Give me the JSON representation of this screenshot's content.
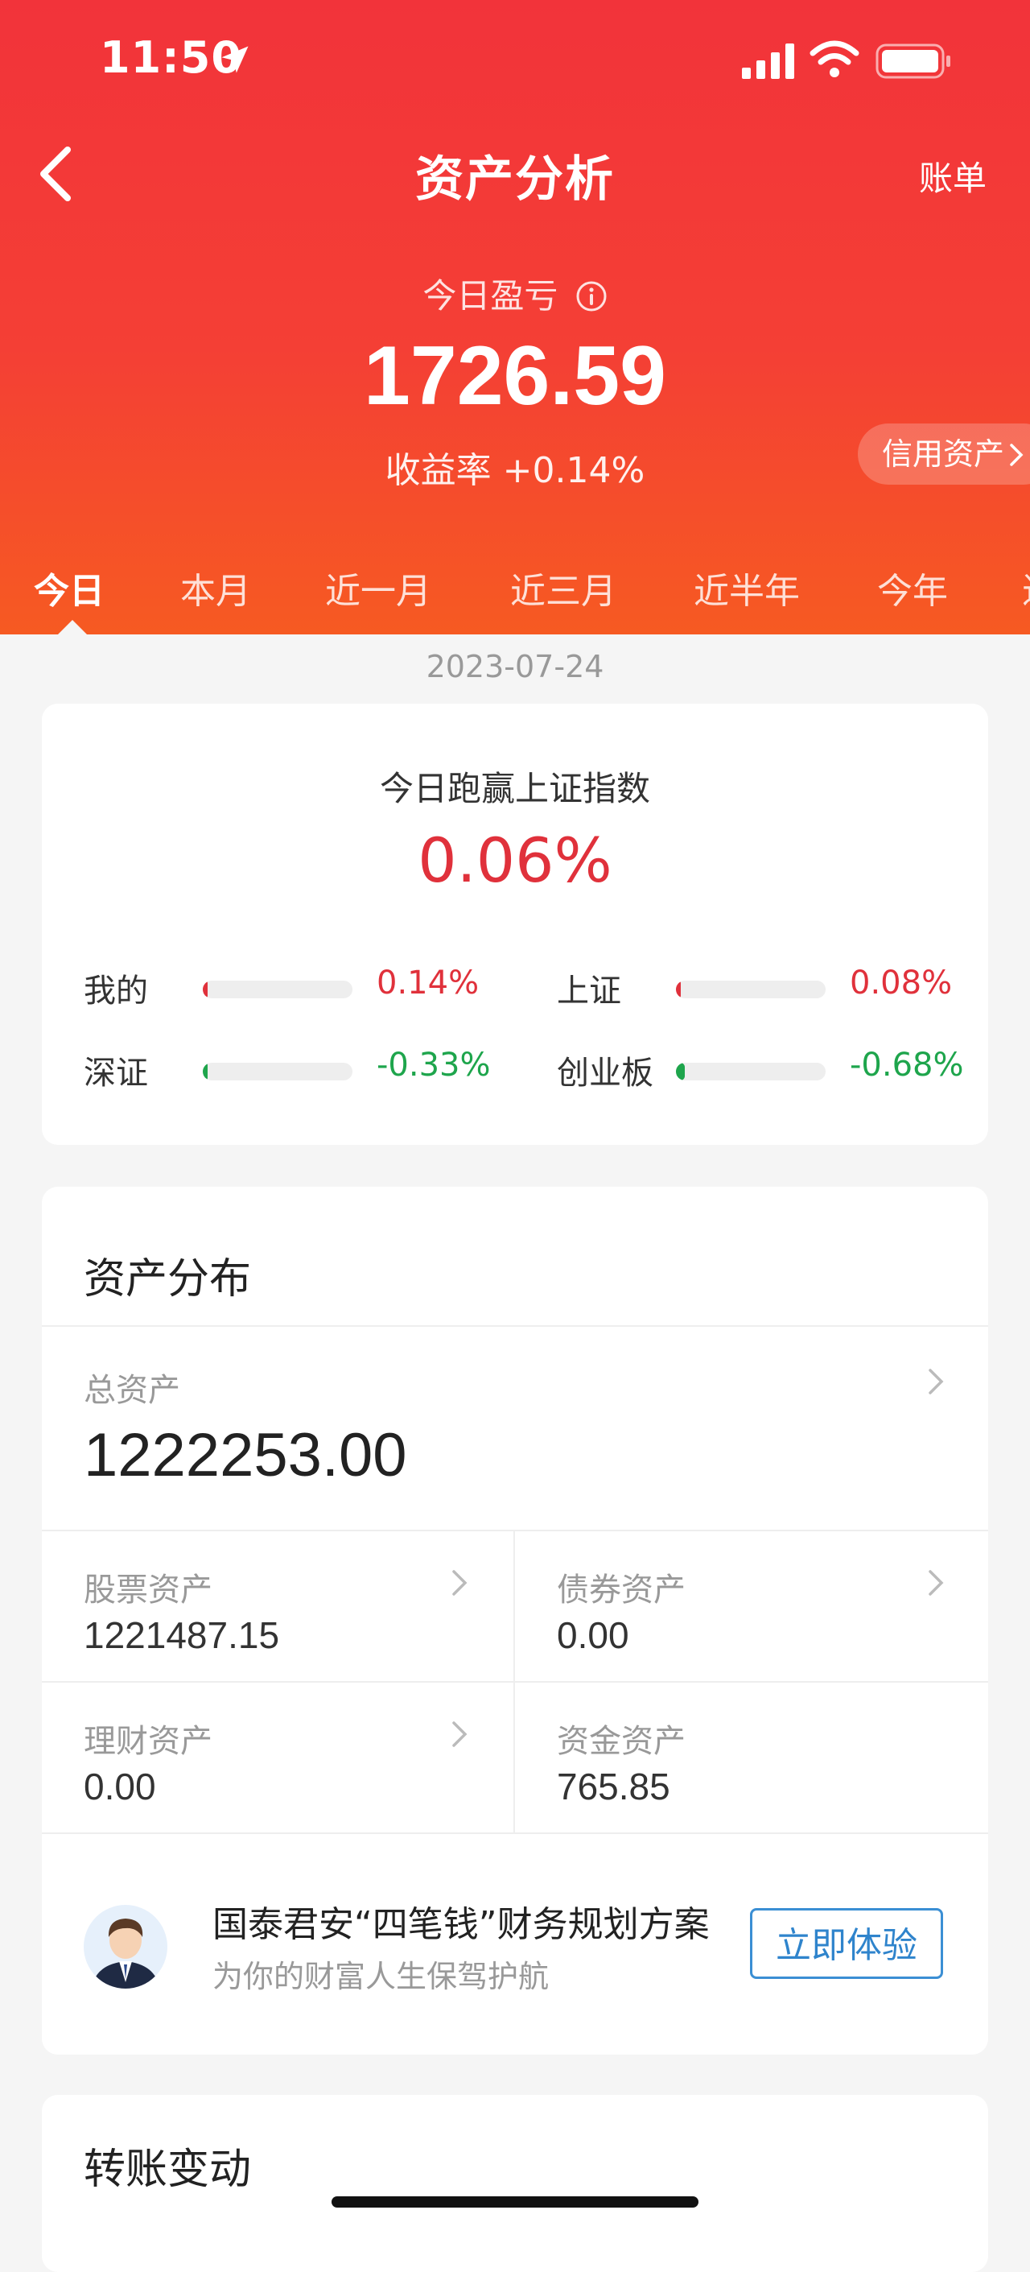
{
  "status": {
    "time": "11:50"
  },
  "nav": {
    "title": "资产分析",
    "bill_label": "账单"
  },
  "profit": {
    "label": "今日盈亏",
    "value": "1726.59",
    "yield_text": "收益率 +0.14%",
    "credit_label": "信用资产"
  },
  "tabs": [
    "今日",
    "本月",
    "近一月",
    "近三月",
    "近半年",
    "今年",
    "近"
  ],
  "date": "2023-07-24",
  "beat": {
    "title": "今日跑赢上证指数",
    "value": "0.06%",
    "items": [
      {
        "label": "我的",
        "pct": "0.14%",
        "level": 0.02,
        "color": "#e0313b"
      },
      {
        "label": "上证",
        "pct": "0.08%",
        "level": 0.01,
        "color": "#e0313b"
      },
      {
        "label": "深证",
        "pct": "-0.33%",
        "level": 0.03,
        "color": "#1ea54c"
      },
      {
        "label": "创业板",
        "pct": "-0.68%",
        "level": 0.06,
        "color": "#1ea54c"
      }
    ]
  },
  "assets": {
    "title": "资产分布",
    "total_label": "总资产",
    "total_value": "1222253.00",
    "cells": [
      {
        "label": "股票资产",
        "value": "1221487.15"
      },
      {
        "label": "债券资产",
        "value": "0.00"
      },
      {
        "label": "理财资产",
        "value": "0.00"
      },
      {
        "label": "资金资产",
        "value": "765.85"
      }
    ],
    "promo": {
      "title": "国泰君安“四笔钱”财务规划方案",
      "subtitle": "为你的财富人生保驾护航",
      "button": "立即体验"
    }
  },
  "transfer": {
    "title": "转账变动"
  },
  "colors": {
    "accent_red": "#f2333a",
    "gain": "#e0313b",
    "loss": "#1ea54c",
    "link_blue": "#2f84cc"
  }
}
